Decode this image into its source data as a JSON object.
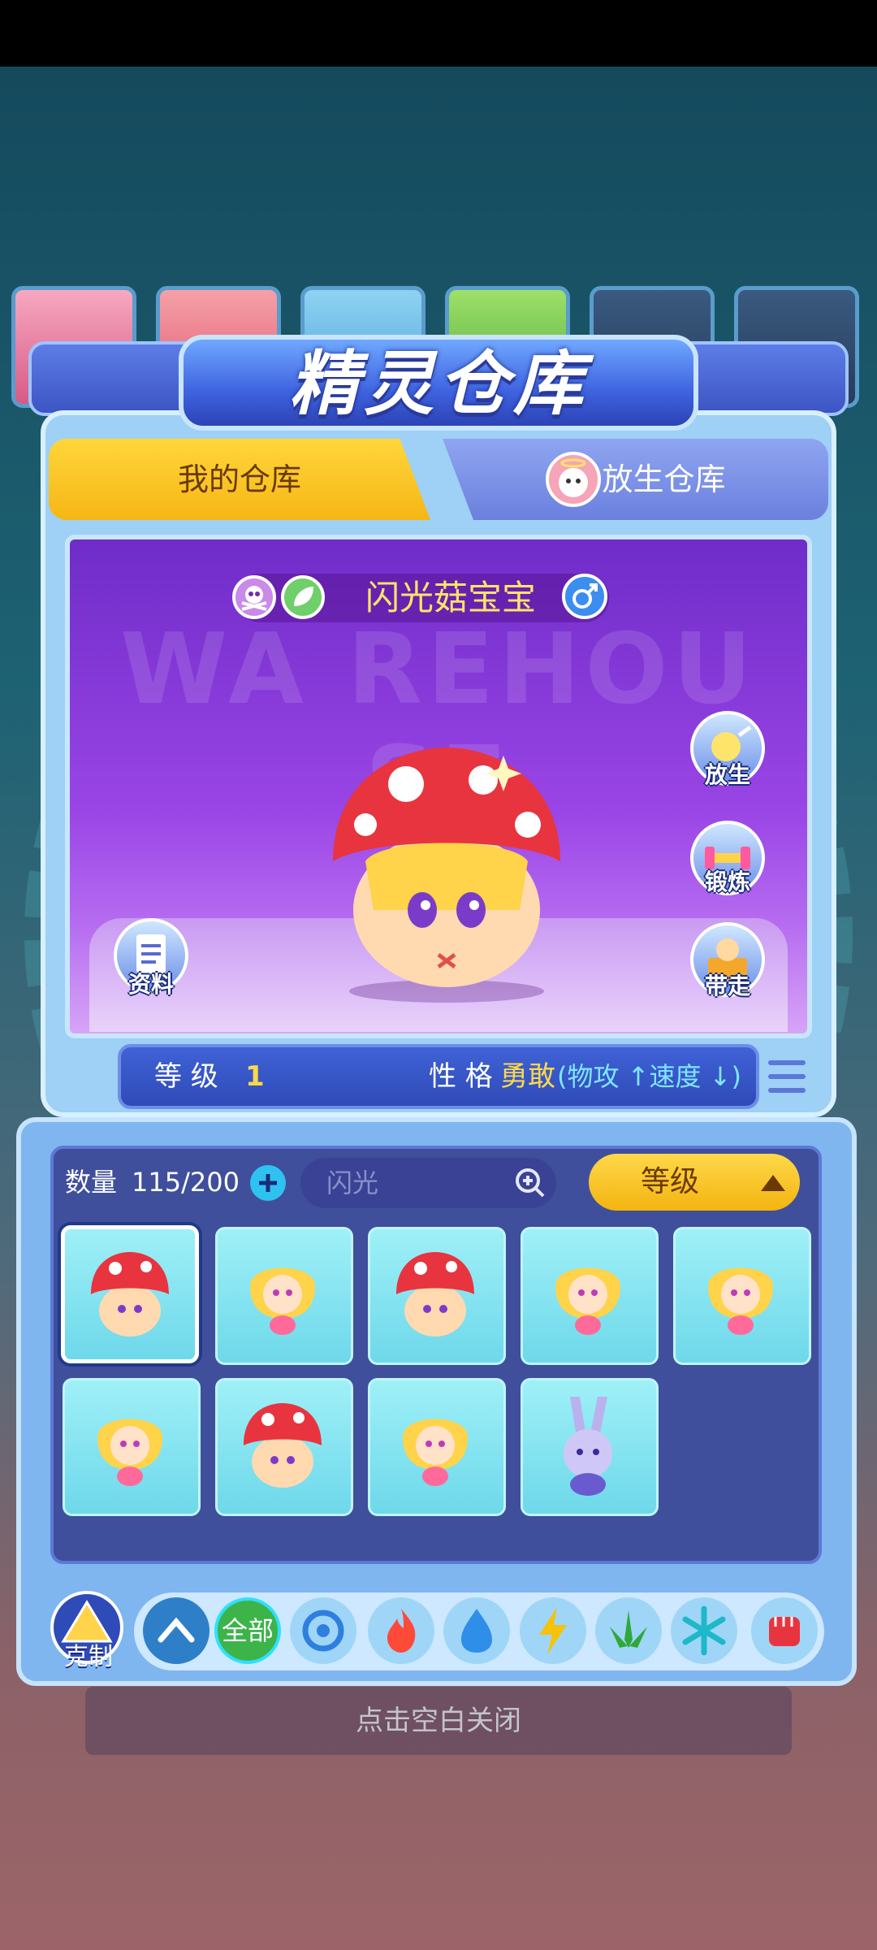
{
  "title": "精灵仓库",
  "tabs": [
    {
      "label": "我的仓库",
      "active": true
    },
    {
      "label": "放生仓库",
      "active": false
    }
  ],
  "pet": {
    "name": "闪光菇宝宝",
    "watermark": "WA REHOU SE",
    "level_label": "等 级",
    "level_value": "1",
    "nature_label": "性 格",
    "nature_value": "勇敢",
    "nature_effect": "(物攻 ↑速度 ↓)",
    "gender_icon": "male-icon",
    "type_icons": [
      "poison-type-icon",
      "grass-type-icon"
    ]
  },
  "side_actions": [
    {
      "label": "资料",
      "icon": "document-icon"
    },
    {
      "label": "放生",
      "icon": "release-icon"
    },
    {
      "label": "锻炼",
      "icon": "dumbbell-icon"
    },
    {
      "label": "带走",
      "icon": "carry-icon"
    }
  ],
  "storage": {
    "count_label": "数量",
    "count_value": "115/200",
    "search_value": "闪光",
    "sort_label": "等级",
    "slots": [
      "mushroom",
      "fairy",
      "mushroom",
      "fairy",
      "fairy",
      "fairy",
      "mushroom",
      "fairy",
      "rabbit"
    ]
  },
  "filters": {
    "counter_label": "克制",
    "all_label": "全部",
    "icons": [
      "up-arrow-icon",
      "all-icon",
      "normal-type-icon",
      "fire-type-icon",
      "water-type-icon",
      "electric-type-icon",
      "grass-type-icon",
      "ice-type-icon",
      "fighting-type-icon"
    ]
  },
  "close_hint": "点击空白关闭",
  "colors": {
    "accent_yellow": "#f6b615",
    "tab_blue": "#6b80de",
    "stage_purple": "#9a45e6",
    "name_yellow": "#ffe46b"
  }
}
